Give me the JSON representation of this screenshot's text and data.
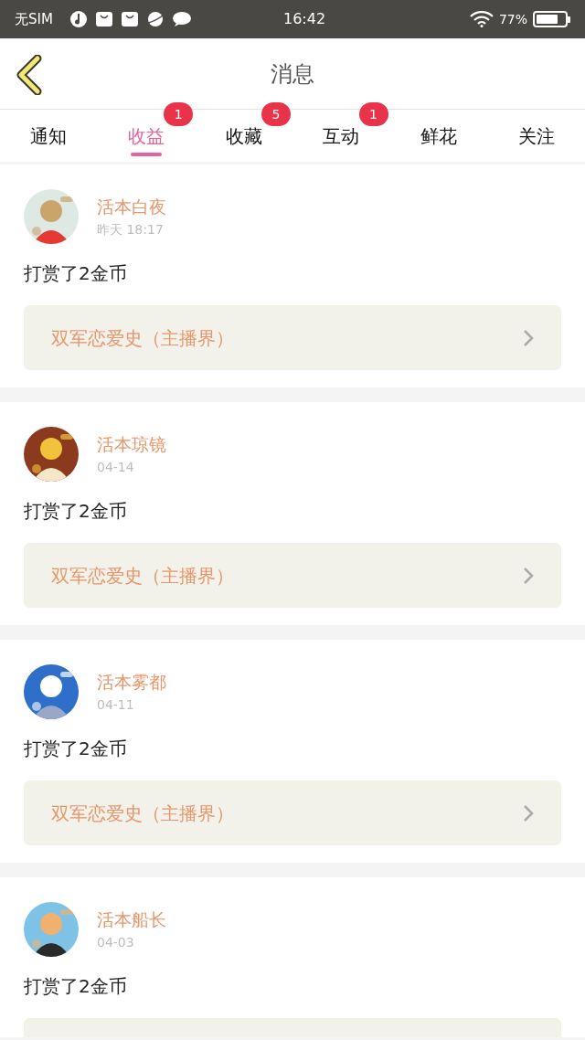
{
  "status_bar": {
    "carrier": "无SIM",
    "time": "16:42",
    "battery": "77%"
  },
  "header": {
    "title": "消息"
  },
  "tabs": [
    {
      "label": "通知",
      "selected": false
    },
    {
      "label": "收益",
      "selected": true,
      "badge": "1"
    },
    {
      "label": "收藏",
      "selected": false,
      "badge": "5"
    },
    {
      "label": "互动",
      "selected": false,
      "badge": "1"
    },
    {
      "label": "鲜花",
      "selected": false
    },
    {
      "label": "关注",
      "selected": false
    }
  ],
  "messages": [
    {
      "name": "活本白夜",
      "time": "昨天 18:17",
      "text": "打赏了2金币",
      "link": "双军恋爱史（主播界）"
    },
    {
      "name": "活本琼镜",
      "time": "04-14",
      "text": "打赏了2金币",
      "link": "双军恋爱史（主播界）"
    },
    {
      "name": "活本雾都",
      "time": "04-11",
      "text": "打赏了2金币",
      "link": "双军恋爱史（主播界）"
    },
    {
      "name": "活本船长",
      "time": "04-03",
      "text": "打赏了2金币"
    }
  ]
}
